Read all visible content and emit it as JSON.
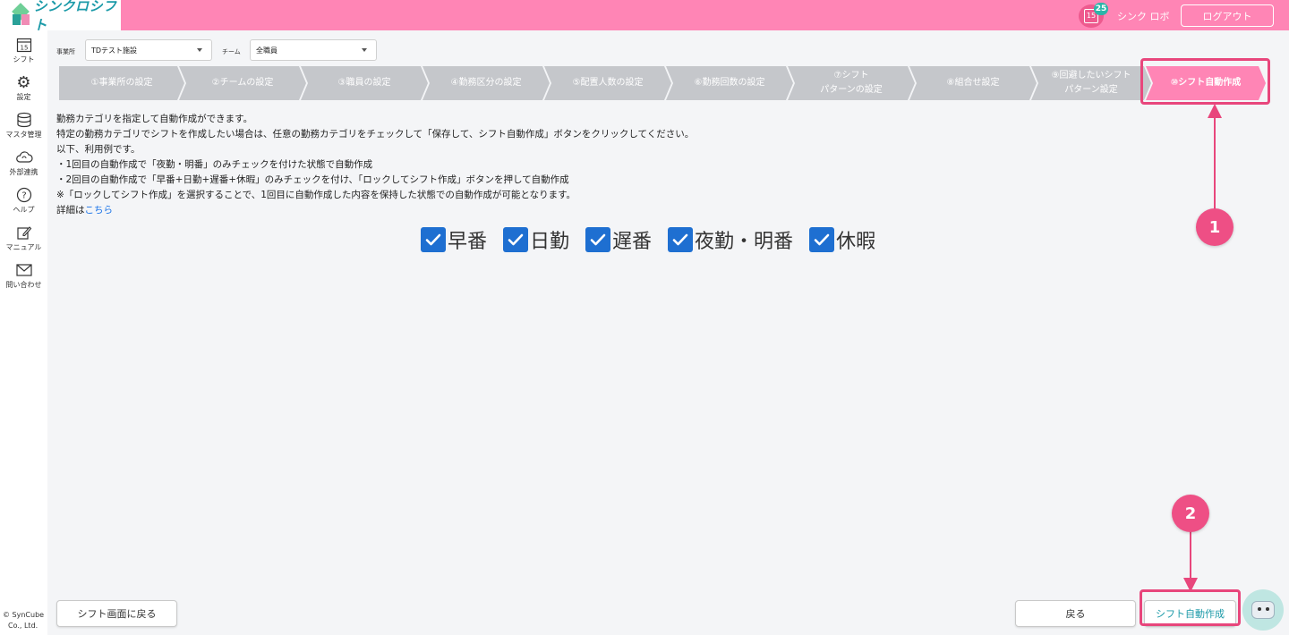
{
  "app": {
    "logo_text": "シンクロシフト",
    "calendar_day": "15",
    "notification_count": "25",
    "user_name": "シンク ロボ",
    "logout_label": "ログアウト"
  },
  "sidebar": {
    "items": [
      {
        "label": "シフト",
        "icon": "calendar-icon",
        "glyph": "15"
      },
      {
        "label": "設定",
        "icon": "gear-icon",
        "glyph": "⚙"
      },
      {
        "label": "マスタ管理",
        "icon": "database-icon",
        "glyph": "☰"
      },
      {
        "label": "外部連携",
        "icon": "cloud-sync-icon",
        "glyph": "☁"
      },
      {
        "label": "ヘルプ",
        "icon": "help-icon",
        "glyph": "?"
      },
      {
        "label": "マニュアル",
        "icon": "edit-icon",
        "glyph": "✎"
      },
      {
        "label": "問い合わせ",
        "icon": "mail-icon",
        "glyph": "✉"
      }
    ],
    "copyright_line1": "© SynCube",
    "copyright_line2": "Co., Ltd."
  },
  "filters": {
    "office_label": "事業所",
    "office_value": "TDテスト施設",
    "team_label": "チーム",
    "team_value": "全職員"
  },
  "steps": [
    {
      "line1": "①事業所の設定",
      "line2": ""
    },
    {
      "line1": "②チームの設定",
      "line2": ""
    },
    {
      "line1": "③職員の設定",
      "line2": ""
    },
    {
      "line1": "④勤務区分の設定",
      "line2": ""
    },
    {
      "line1": "⑤配置人数の設定",
      "line2": ""
    },
    {
      "line1": "⑥勤務回数の設定",
      "line2": ""
    },
    {
      "line1": "⑦シフト",
      "line2": "パターンの設定"
    },
    {
      "line1": "⑧組合せ設定",
      "line2": ""
    },
    {
      "line1": "⑨回避したいシフト",
      "line2": "パターン設定"
    },
    {
      "line1": "⑩シフト自動作成",
      "line2": ""
    }
  ],
  "description": {
    "line1": "勤務カテゴリを指定して自動作成ができます。",
    "line2": "特定の勤務カテゴリでシフトを作成したい場合は、任意の勤務カテゴリをチェックして「保存して、シフト自動作成」ボタンをクリックしてください。",
    "line3": "以下、利用例です。",
    "line4": "・1回目の自動作成で「夜勤・明番」のみチェックを付けた状態で自動作成",
    "line5": "・2回目の自動作成で「早番+日勤+遅番+休暇」のみチェックを付け、「ロックしてシフト作成」ボタンを押して自動作成",
    "line6": "※「ロックしてシフト作成」を選択することで、1回目に自動作成した内容を保持した状態での自動作成が可能となります。",
    "details_prefix": "詳細は",
    "details_link": "こちら"
  },
  "categories": [
    {
      "label": "早番",
      "checked": true
    },
    {
      "label": "日勤",
      "checked": true
    },
    {
      "label": "遅番",
      "checked": true
    },
    {
      "label": "夜勤・明番",
      "checked": true
    },
    {
      "label": "休暇",
      "checked": true
    }
  ],
  "callouts": {
    "first": "1",
    "second": "2"
  },
  "buttons": {
    "back_to_shift": "シフト画面に戻る",
    "back": "戻る",
    "auto_create": "シフト自動作成"
  },
  "colors": {
    "header_pink": "#ff85b5",
    "highlight_red": "#e8467c",
    "checkbox_blue": "#1e6fd1",
    "step_gray": "#c5c7cb",
    "link_blue": "#1a73e8"
  }
}
